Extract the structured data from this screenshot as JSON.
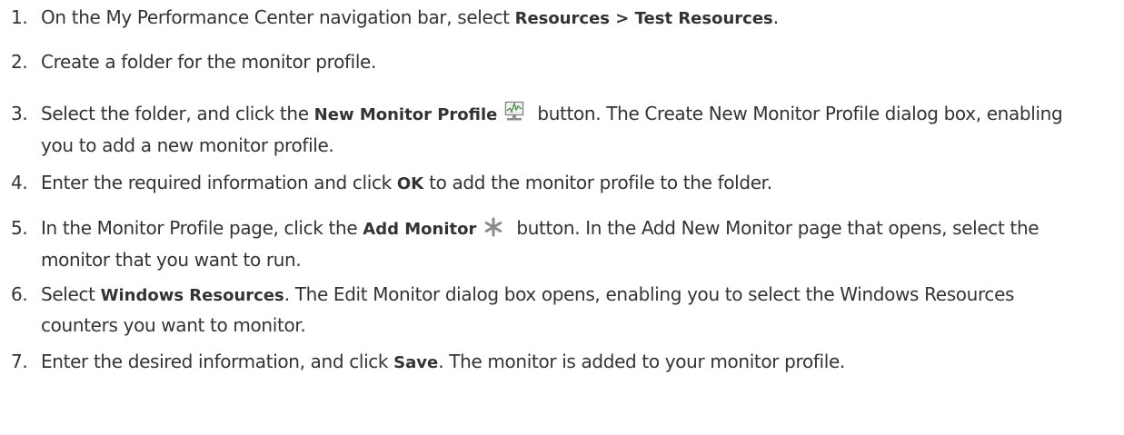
{
  "steps": [
    {
      "number": "1.",
      "text_before": "On the My Performance Center navigation bar, select ",
      "bold": "Resources > Test Resources",
      "text_after": "."
    },
    {
      "number": "2.",
      "text": "Create a folder for the monitor profile."
    },
    {
      "number": "3.",
      "text_before": "Select the folder, and click the ",
      "bold": "New Monitor Profile",
      "icon": "new-monitor-profile-icon",
      "text_after": "button. The Create New Monitor Profile dialog box, enabling you to add a new monitor profile."
    },
    {
      "number": "4.",
      "text_before": "Enter the required information and click ",
      "bold": "OK",
      "text_after": " to add the monitor profile to the folder."
    },
    {
      "number": "5.",
      "text_before": "In the Monitor Profile page, click the ",
      "bold": "Add Monitor",
      "icon": "asterisk-icon",
      "text_after": "button. In the Add New Monitor page that opens, select the monitor that you want to run."
    },
    {
      "number": "6.",
      "text_before": "Select ",
      "bold": "Windows Resources",
      "text_after": ". The Edit Monitor dialog box opens, enabling you to select the Windows Resources counters you want to monitor."
    },
    {
      "number": "7.",
      "text_before": "Enter the desired information, and click ",
      "bold": "Save",
      "text_after": ". The monitor is added to your monitor profile."
    }
  ],
  "colors": {
    "text": "#333333",
    "icon_gray": "#8c8c8c",
    "icon_green": "#4a9a4a"
  }
}
